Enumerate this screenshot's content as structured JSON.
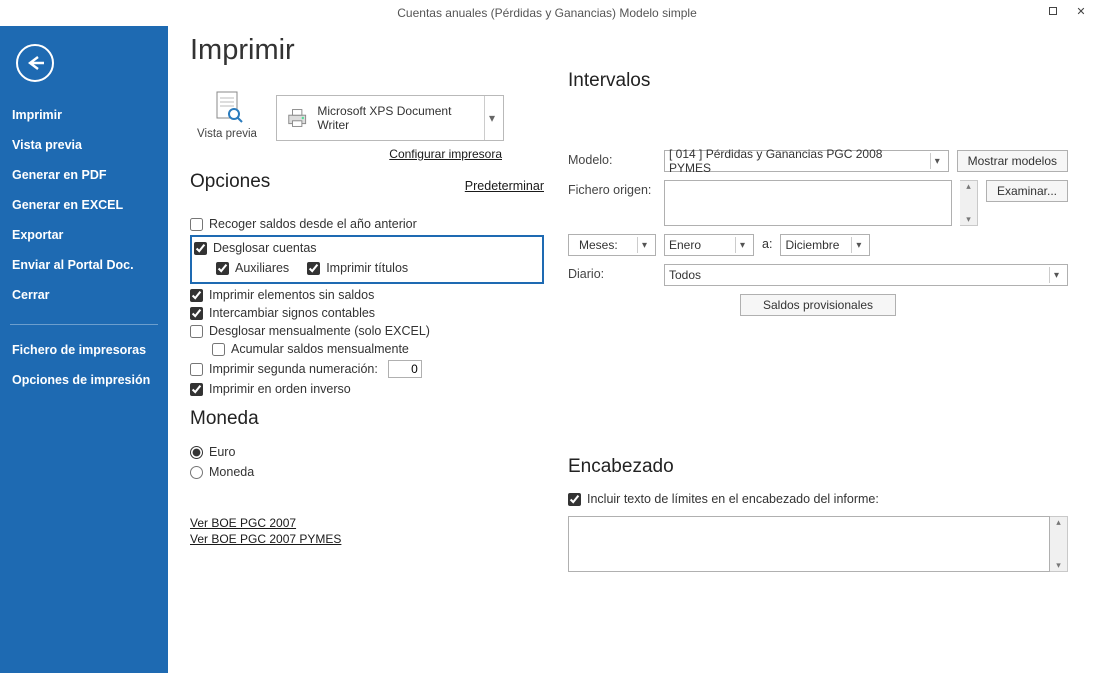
{
  "window": {
    "title": "Cuentas anuales (Pérdidas y Ganancias) Modelo simple"
  },
  "sidebar": {
    "items": [
      "Imprimir",
      "Vista previa",
      "Generar en PDF",
      "Generar en EXCEL",
      "Exportar",
      "Enviar al Portal Doc.",
      "Cerrar"
    ],
    "items2": [
      "Fichero de impresoras",
      "Opciones de impresión"
    ]
  },
  "page": {
    "heading": "Imprimir",
    "opciones_h": "Opciones",
    "moneda_h": "Moneda",
    "intervalos_h": "Intervalos",
    "encabezado_h": "Encabezado"
  },
  "preview": {
    "label": "Vista previa",
    "printer": "Microsoft XPS Document Writer",
    "configure_link": "Configurar impresora",
    "predet_link": "Predeterminar"
  },
  "options": {
    "recoger": "Recoger saldos desde el año anterior",
    "desglosar": "Desglosar cuentas",
    "auxiliares": "Auxiliares",
    "imprimir_titulos": "Imprimir títulos",
    "imprimir_elem": "Imprimir elementos sin saldos",
    "intercambiar": "Intercambiar signos contables",
    "desg_mensual": "Desglosar mensualmente (solo EXCEL)",
    "acumular": "Acumular saldos mensualmente",
    "segunda_num": "Imprimir segunda numeración:",
    "segunda_num_val": "0",
    "orden_inverso": "Imprimir en orden inverso"
  },
  "moneda": {
    "euro": "Euro",
    "moneda": "Moneda"
  },
  "boe": {
    "link1": "Ver BOE PGC 2007",
    "link2": "Ver BOE PGC 2007 PYMES"
  },
  "intervalos": {
    "modelo_label": "Modelo:",
    "modelo_value": "[ 014 ] Pérdidas y Ganancias PGC 2008 PYMES",
    "mostrar_btn": "Mostrar modelos",
    "fichero_label": "Fichero origen:",
    "examinar_btn": "Examinar...",
    "meses_label": "Meses:",
    "mes_from": "Enero",
    "a_label": "a:",
    "mes_to": "Diciembre",
    "diario_label": "Diario:",
    "diario_value": "Todos",
    "saldos_btn": "Saldos provisionales"
  },
  "encabezado": {
    "check_label": "Incluir texto de límites en el encabezado del informe:",
    "text": ""
  }
}
